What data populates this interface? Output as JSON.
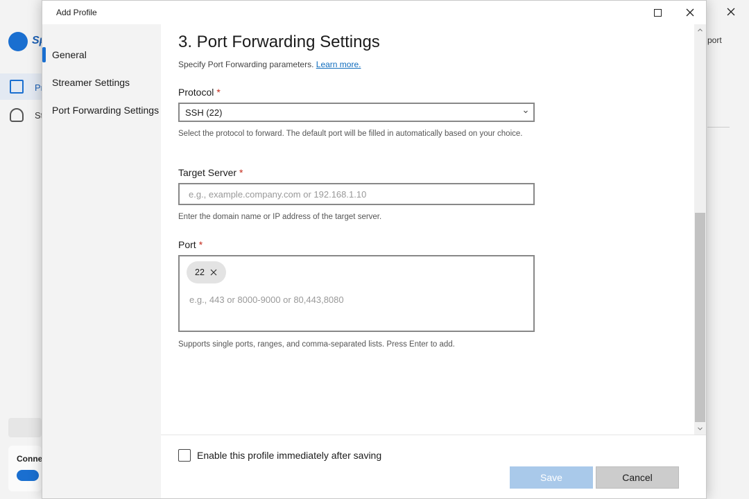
{
  "background_app": {
    "logo_text": "Sp",
    "nav": [
      {
        "label": "Pr"
      },
      {
        "label": "St"
      }
    ],
    "right_text": "port",
    "panel_text": "Conne"
  },
  "dialog": {
    "title": "Add Profile",
    "sidebar": {
      "items": [
        {
          "label": "General",
          "active": true
        },
        {
          "label": "Streamer Settings",
          "active": false
        },
        {
          "label": "Port Forwarding Settings",
          "active": false
        }
      ]
    },
    "page": {
      "title": "3. Port Forwarding Settings",
      "subtitle": "Specify Port Forwarding parameters.",
      "learn_more": "Learn more."
    },
    "protocol": {
      "label": "Protocol",
      "required_mark": "*",
      "selected": "SSH (22)",
      "help": "Select the protocol to forward. The default port will be filled in automatically based on your choice."
    },
    "target_server": {
      "label": "Target Server",
      "required_mark": "*",
      "value": "",
      "placeholder": "e.g., example.company.com or 192.168.1.10",
      "help": "Enter the domain name or IP address of the target server."
    },
    "port": {
      "label": "Port",
      "required_mark": "*",
      "chips": [
        "22"
      ],
      "placeholder": "e.g., 443 or 8000-9000 or 80,443,8080",
      "help": "Supports single ports, ranges, and comma-separated lists. Press Enter to add."
    },
    "footer": {
      "enable_label": "Enable this profile immediately after saving",
      "enable_checked": false,
      "save_label": "Save",
      "cancel_label": "Cancel"
    }
  },
  "colors": {
    "accent": "#1a6fd0",
    "link": "#0f6cbd",
    "required": "#c42b1c",
    "save_disabled": "#a9c9ea"
  }
}
